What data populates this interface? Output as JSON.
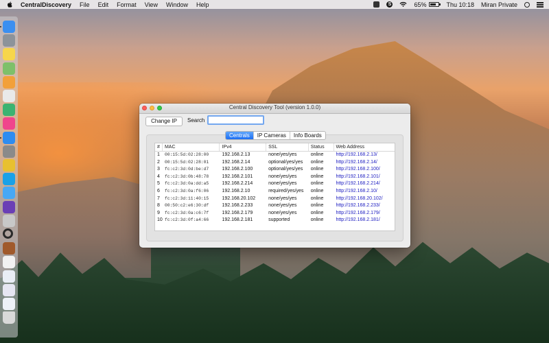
{
  "menubar": {
    "app_name": "CentralDiscovery",
    "menus": [
      "File",
      "Edit",
      "Format",
      "View",
      "Window",
      "Help"
    ],
    "battery_percent": "65%",
    "battery_level": 0.65,
    "clock": "Thu 10:18",
    "user": "Miran Private",
    "skype_glyph": "S",
    "icons": [
      "apple-icon",
      "square-icon",
      "skype-icon",
      "wifi-icon",
      "battery-icon",
      "spotlight-icon",
      "notification-list-icon"
    ]
  },
  "dock": {
    "items": [
      {
        "name": "finder",
        "color": "#3b8ff0"
      },
      {
        "name": "launchpad",
        "color": "#8d939a"
      },
      {
        "name": "notes",
        "color": "#f7d64b"
      },
      {
        "name": "maps",
        "color": "#7ec06a"
      },
      {
        "name": "photos",
        "color": "#f2a03a"
      },
      {
        "name": "textedit",
        "color": "#e9e9e9"
      },
      {
        "name": "numbers",
        "color": "#3cb371"
      },
      {
        "name": "itunes",
        "color": "#f0458c"
      },
      {
        "name": "app-store",
        "color": "#2e8cf0"
      },
      {
        "name": "system-preferences",
        "color": "#8a8a8a"
      },
      {
        "name": "chrome",
        "color": "#e8c030"
      },
      {
        "name": "skype",
        "color": "#1aa1e8"
      },
      {
        "name": "messages",
        "color": "#48a8f5"
      },
      {
        "name": "visual-studio",
        "color": "#6a3fb5"
      },
      {
        "name": "screenshot-tool",
        "color": "#c8c8c8"
      },
      {
        "name": "magnifier",
        "color": "#2a2a2a"
      },
      {
        "name": "central-discovery",
        "color": "#a05a2c"
      },
      {
        "name": "document-1",
        "color": "#f2f2f2"
      },
      {
        "name": "document-2",
        "color": "#e9edf5"
      },
      {
        "name": "document-3",
        "color": "#e6e6f2"
      },
      {
        "name": "document-4",
        "color": "#eef2f8"
      },
      {
        "name": "trash",
        "color": "#d9d9d9"
      }
    ]
  },
  "window": {
    "title": "Central Discovery Tool (version 1.0.0)",
    "change_ip_label": "Change IP",
    "search_label": "Search",
    "search_value": "",
    "tabs": [
      {
        "label": "Centrals",
        "active": true
      },
      {
        "label": "IP Cameras",
        "active": false
      },
      {
        "label": "Info Boards",
        "active": false
      }
    ],
    "table": {
      "columns": [
        "#",
        "MAC",
        "IPv4",
        "SSL",
        "Status",
        "Web Address"
      ],
      "rows": [
        [
          "1",
          "00:15:5d:02:28:00",
          "192.168.2.13",
          "none/yes/yes",
          "online",
          "http://192.168.2.13/"
        ],
        [
          "2",
          "00:15:5d:02:28:01",
          "192.168.2.14",
          "optional/yes/yes",
          "online",
          "http://192.168.2.14/"
        ],
        [
          "3",
          "fc:c2:3d:0d:be:d7",
          "192.168.2.100",
          "optional/yes/yes",
          "online",
          "http://192.168.2.100/"
        ],
        [
          "4",
          "fc:c2:3d:0b:48:78",
          "192.168.2.101",
          "none/yes/yes",
          "online",
          "http://192.168.2.101/"
        ],
        [
          "5",
          "fc:c2:3d:0a:dd:a5",
          "192.168.2.214",
          "none/yes/yes",
          "online",
          "http://192.168.2.214/"
        ],
        [
          "6",
          "fc:c2:3d:0a:f6:06",
          "192.168.2.10",
          "required/yes/yes",
          "online",
          "http://192.168.2.10/"
        ],
        [
          "7",
          "fc:c2:3d:11:40:15",
          "192.168.20.102",
          "none/yes/yes",
          "online",
          "http://192.168.20.102/"
        ],
        [
          "8",
          "00:50:c2:e6:30:df",
          "192.168.2.233",
          "none/yes/yes",
          "online",
          "http://192.168.2.233/"
        ],
        [
          "9",
          "fc:c2:3d:0a:c6:7f",
          "192.168.2.179",
          "none/yes/yes",
          "online",
          "http://192.168.2.179/"
        ],
        [
          "10",
          "fc:c2:3d:0f:a4:66",
          "192.168.2.181",
          "supported",
          "online",
          "http://192.168.2.181/"
        ]
      ]
    }
  },
  "colors": {
    "accent": "#1d6ff3",
    "link": "#1a1ac0",
    "close": "#fc605b",
    "minimize": "#fdbc40",
    "zoom": "#34c84a"
  }
}
